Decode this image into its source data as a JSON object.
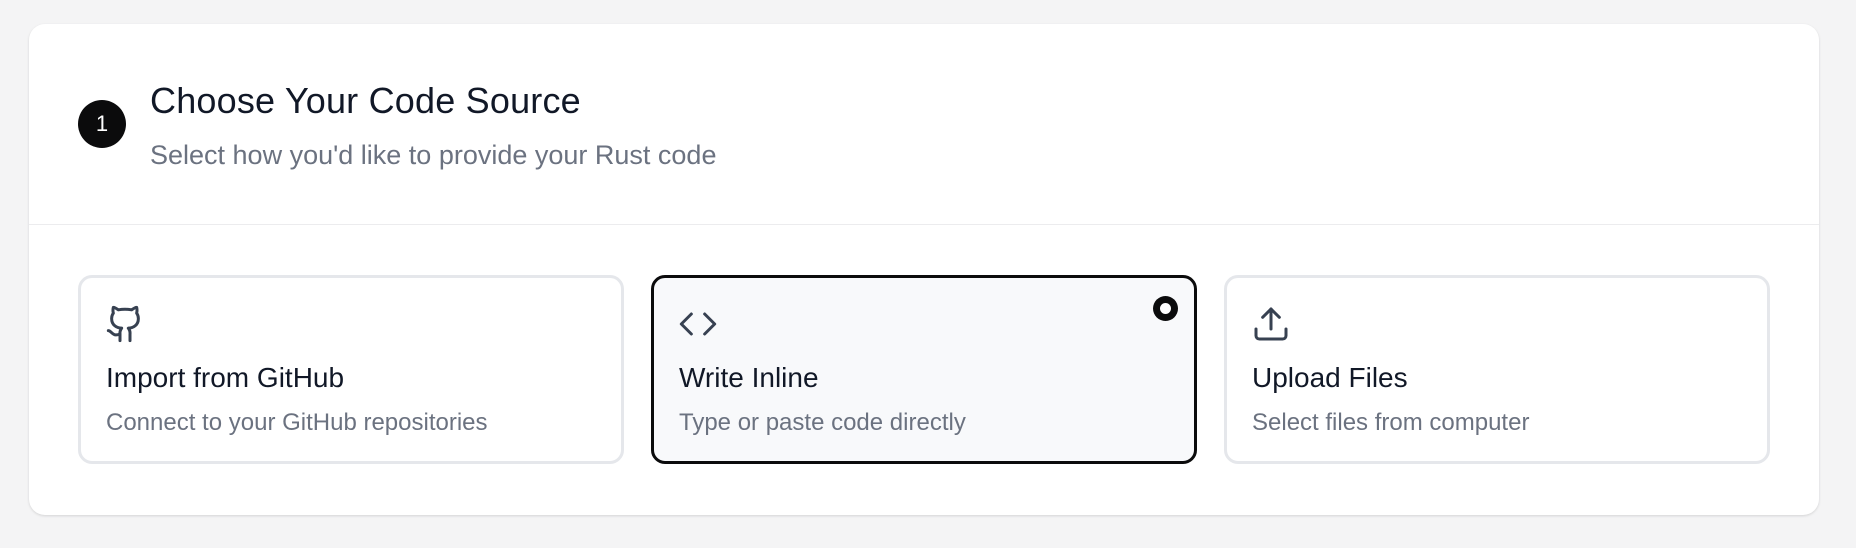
{
  "step": {
    "number": "1",
    "title": "Choose Your Code Source",
    "subtitle": "Select how you'd like to provide your Rust code"
  },
  "options": [
    {
      "title": "Import from GitHub",
      "description": "Connect to your GitHub repositories",
      "icon": "github-icon",
      "selected": false
    },
    {
      "title": "Write Inline",
      "description": "Type or paste code directly",
      "icon": "code-icon",
      "selected": true
    },
    {
      "title": "Upload Files",
      "description": "Select files from computer",
      "icon": "upload-icon",
      "selected": false
    }
  ],
  "colors": {
    "accent": "#0b0b0c",
    "muted_text": "#6b7280",
    "border": "#e5e7eb",
    "selected_bg": "#f8f9fb"
  }
}
